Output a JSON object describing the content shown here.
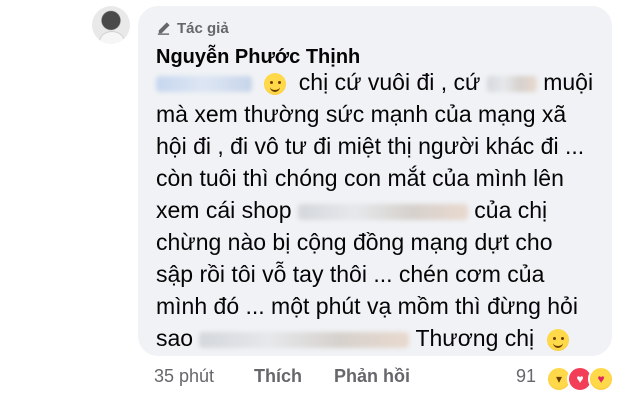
{
  "comment": {
    "badge": "Tác giả",
    "author": "Nguyễn Phước Thịnh",
    "segments": {
      "l1": "chị cứ vuôi đi , cứ",
      "l1b": "muội",
      "l2": "mà xem thường sức mạnh của mạng xã",
      "l3": "hội đi , đi vô tư đi miệt thị người khác đi ...",
      "l4": "còn tuôi thì chóng con mắt của mình lên",
      "l5a": "xem cái shop",
      "l5b": "của chị",
      "l6": "chừng nào bị cộng đồng mạng dựt cho",
      "l7": "sập rồi tôi vỗ tay thôi ... chén cơm của",
      "l8": "mình đó ... một phút vạ mồm thì đừng hỏi",
      "l9a": "sao",
      "l9b": "Thương chị"
    }
  },
  "footer": {
    "time": "35 phút",
    "like": "Thích",
    "reply": "Phản hồi",
    "reaction_count": "91"
  },
  "reactions": [
    "haha-icon",
    "love-icon",
    "care-icon"
  ]
}
